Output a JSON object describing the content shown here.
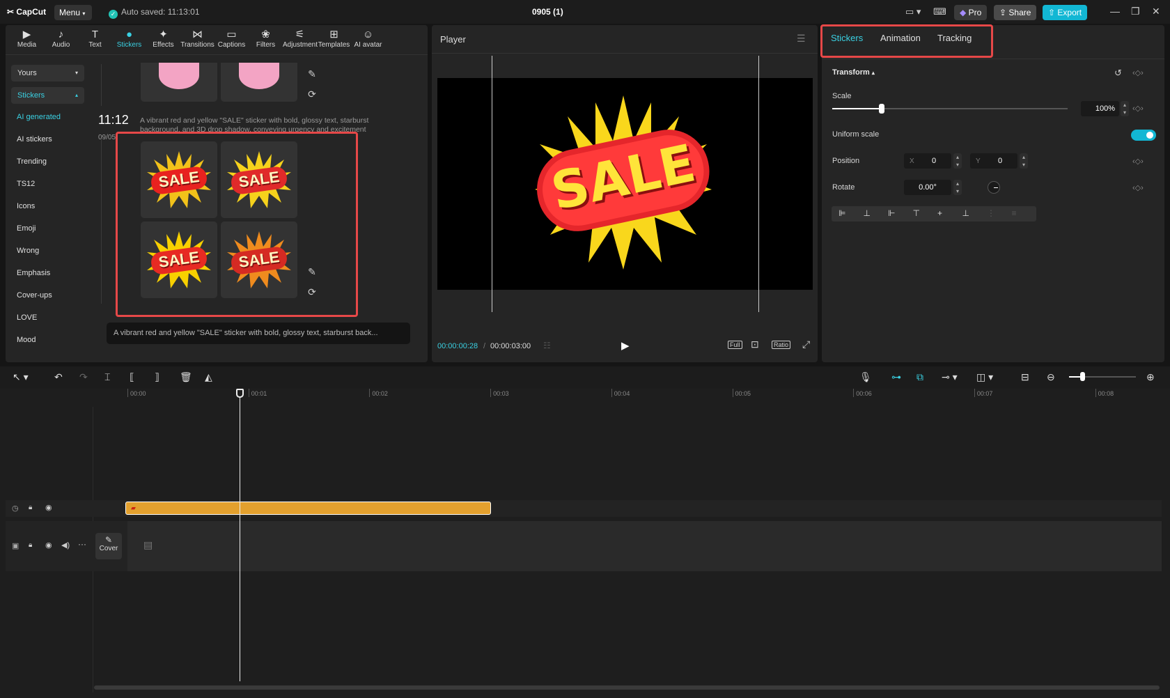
{
  "app": {
    "logo": "CapCut",
    "menu_label": "Menu",
    "auto_saved": "Auto saved: 11:13:01",
    "doc_title": "0905 (1)",
    "pro_label": "Pro",
    "share_label": "Share",
    "export_label": "Export"
  },
  "toolbar": [
    {
      "label": "Media",
      "icon": "media-icon"
    },
    {
      "label": "Audio",
      "icon": "audio-icon"
    },
    {
      "label": "Text",
      "icon": "text-icon"
    },
    {
      "label": "Stickers",
      "icon": "stickers-icon"
    },
    {
      "label": "Effects",
      "icon": "effects-icon"
    },
    {
      "label": "Transitions",
      "icon": "transitions-icon"
    },
    {
      "label": "Captions",
      "icon": "captions-icon"
    },
    {
      "label": "Filters",
      "icon": "filters-icon"
    },
    {
      "label": "Adjustment",
      "icon": "adjustment-icon"
    },
    {
      "label": "Templates",
      "icon": "templates-icon"
    },
    {
      "label": "AI avatar",
      "icon": "ai-avatar-icon"
    }
  ],
  "sidebar": {
    "yours": "Yours",
    "stickers": "Stickers",
    "items": [
      "AI generated",
      "AI stickers",
      "Trending",
      "TS12",
      "Icons",
      "Emoji",
      "Wrong",
      "Emphasis",
      "Cover-ups",
      "LOVE",
      "Mood"
    ]
  },
  "generation": {
    "time": "11:12",
    "date": "09/05",
    "description": "A vibrant red and yellow \"SALE\" sticker with bold, glossy text, starburst background, and 3D drop shadow, conveying urgency and excitement",
    "sticker_text": "SALE",
    "prompt_preview": "A vibrant red and yellow \"SALE\" sticker with bold, glossy text, starburst back..."
  },
  "player": {
    "title": "Player",
    "current_time": "00:00:00:28",
    "total_time": "00:00:03:00",
    "full_label": "Full",
    "ratio_label": "Ratio",
    "preview_text": "SALE"
  },
  "inspector": {
    "tabs": [
      "Stickers",
      "Animation",
      "Tracking"
    ],
    "transform_label": "Transform",
    "scale_label": "Scale",
    "scale_value": "100%",
    "scale_fraction": 0.21,
    "uniform_scale_label": "Uniform scale",
    "uniform_scale_on": true,
    "position_label": "Position",
    "x_label": "X",
    "x_value": "0",
    "y_label": "Y",
    "y_value": "0",
    "rotate_label": "Rotate",
    "rotate_value": "0.00°"
  },
  "timeline": {
    "ruler": [
      "00:00",
      "00:01",
      "00:02",
      "00:03",
      "00:04",
      "00:05",
      "00:06",
      "00:07",
      "00:08"
    ],
    "cover_label": "Cover"
  },
  "colors": {
    "accent": "#3ad1e3",
    "export": "#12b7d4",
    "clip": "#e3a02e",
    "highlight": "#e64848"
  }
}
